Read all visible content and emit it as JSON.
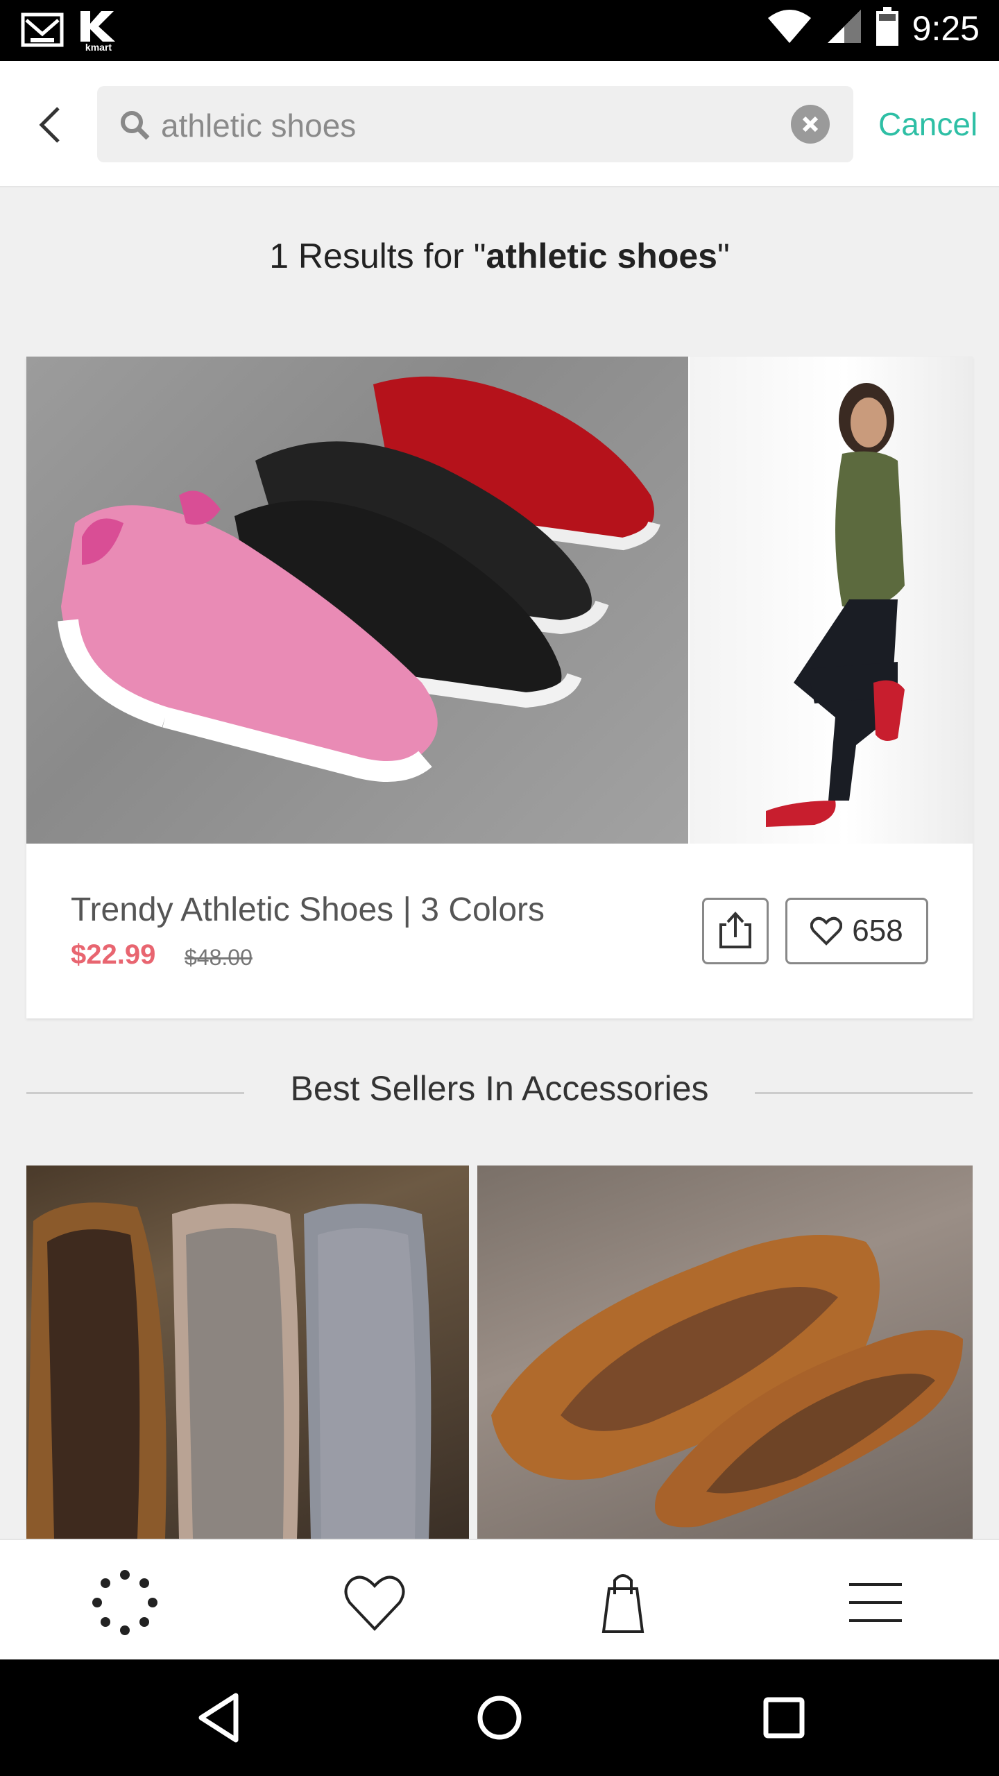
{
  "status_bar": {
    "time": "9:25",
    "left_icons": [
      "gmail-icon",
      "kmart-icon"
    ],
    "kmart_label": "kmart",
    "right_icons": [
      "wifi-icon",
      "signal-icon",
      "battery-icon"
    ]
  },
  "search": {
    "query": "athletic shoes",
    "cancel_label": "Cancel"
  },
  "results": {
    "prefix": "1 Results for \"",
    "query_bold": "athletic shoes",
    "suffix": "\""
  },
  "product": {
    "name": "Trendy Athletic Shoes | 3 Colors",
    "price": "$22.99",
    "original_price": "$48.00",
    "like_count": "658"
  },
  "section": {
    "title": "Best Sellers In Accessories"
  },
  "bottom_nav": {
    "items": [
      "loading-dots-icon",
      "heart-icon",
      "shopping-bag-icon",
      "menu-icon"
    ]
  },
  "system_nav": [
    "back-triangle-icon",
    "home-circle-icon",
    "recents-square-icon"
  ],
  "colors": {
    "accent": "#2ebfa5",
    "sale_price": "#e86570"
  }
}
